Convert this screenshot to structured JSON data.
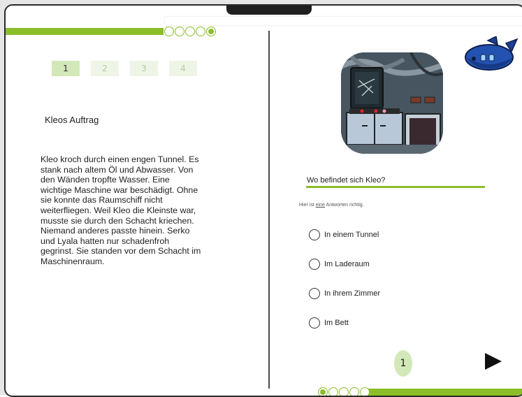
{
  "tabs": [
    "1",
    "2",
    "3",
    "4"
  ],
  "story": {
    "title": "Kleos Auftrag",
    "lines": [
      "Kleo kroch durch einen engen Tunnel. Es",
      "stank nach altem Öl und Abwasser. Von",
      "den Wänden tropfte Wasser. Eine",
      "wichtige Maschine war beschädigt. Ohne",
      "sie konnte das Raumschiff nicht",
      "weiterfliegen. Weil Kleo die Kleinste war,",
      "musste sie durch den Schacht kriechen.",
      "Niemand anderes passte hinein. Serko",
      "und Lyala hatten nur schadenfroh",
      "gegrinst. Sie standen vor dem Schacht im",
      "Maschinenraum."
    ]
  },
  "quiz": {
    "question": "Wo befindet sich Kleo?",
    "hint_before": "Hier ist ",
    "hint_emph": "eine",
    "hint_after": " Antworten richtig.",
    "options": [
      "In einem Tunnel",
      "Im Laderaum",
      "In ihrem Zimmer",
      "Im Bett"
    ]
  },
  "footer": {
    "page": "1"
  },
  "colors": {
    "accent": "#8cbe2a",
    "tab_active": "#d2e8b8",
    "tab_inactive": "#eef5e6"
  },
  "icons": {
    "next": "play-triangle-icon",
    "ship": "spaceship-icon"
  }
}
